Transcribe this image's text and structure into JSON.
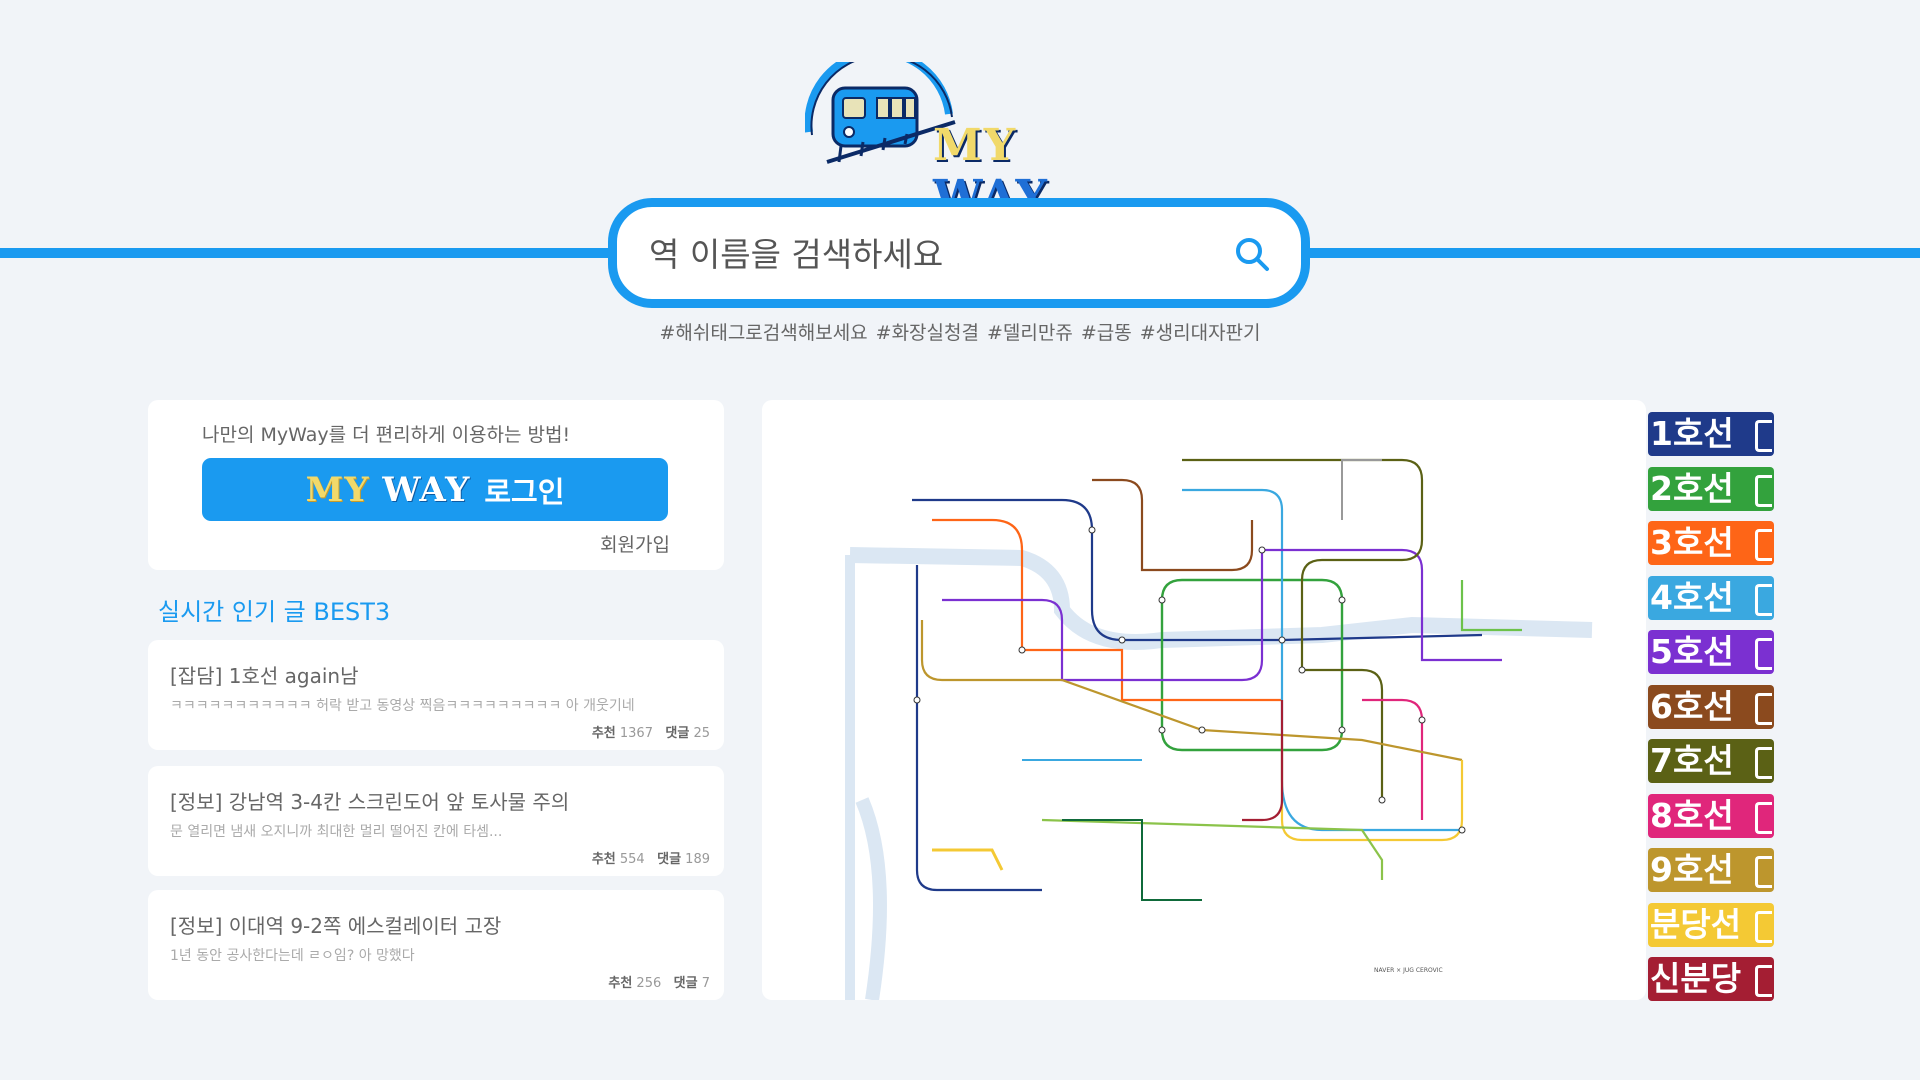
{
  "brand": {
    "my": "MY",
    "way": "WAY"
  },
  "search": {
    "placeholder": "역 이름을 검색하세요"
  },
  "tags": [
    "#해쉬태그로검색해보세요",
    "#화장실청결",
    "#델리만쥬",
    "#급똥",
    "#생리대자판기"
  ],
  "login": {
    "description": "나만의 MyWay를 더 편리하게 이용하는 방법!",
    "button_label": "로그인",
    "signup": "회원가입"
  },
  "best": {
    "title": "실시간 인기 글 BEST3",
    "posts": [
      {
        "title": "[잡담] 1호선 again남",
        "preview": "ㅋㅋㅋㅋㅋㅋㅋㅋㅋㅋㅋ 허락 받고 동영상 찍음ㅋㅋㅋㅋㅋㅋㅋㅋㅋ 아 개웃기네",
        "likes_label": "추천",
        "likes": "1367",
        "comments_label": "댓글",
        "comments": "25"
      },
      {
        "title": "[정보] 강남역 3-4칸 스크린도어 앞 토사물 주의",
        "preview": "문 열리면  냄새 오지니까 최대한 멀리 떨어진 칸에 타셈...",
        "likes_label": "추천",
        "likes": "554",
        "comments_label": "댓글",
        "comments": "189"
      },
      {
        "title": "[정보] 이대역 9-2쪽 에스컬레이터 고장",
        "preview": "1년 동안 공사한다는데 ㄹㅇ임? 아 망했다",
        "likes_label": "추천",
        "likes": "256",
        "comments_label": "댓글",
        "comments": "7"
      }
    ]
  },
  "map": {
    "credit": "NAVER × JUG CEROVIC"
  },
  "lines": [
    {
      "label": "1호선",
      "color": "#1f3a8a"
    },
    {
      "label": "2호선",
      "color": "#33a23d"
    },
    {
      "label": "3호선",
      "color": "#fe6517"
    },
    {
      "label": "4호선",
      "color": "#3aa8e0"
    },
    {
      "label": "5호선",
      "color": "#7b30d1"
    },
    {
      "label": "6호선",
      "color": "#8b4a1e"
    },
    {
      "label": "7호선",
      "color": "#5b6115"
    },
    {
      "label": "8호선",
      "color": "#e0267b"
    },
    {
      "label": "9호선",
      "color": "#bd962d"
    },
    {
      "label": "분당선",
      "color": "#f4c934"
    },
    {
      "label": "신분당",
      "color": "#a41e33"
    }
  ]
}
